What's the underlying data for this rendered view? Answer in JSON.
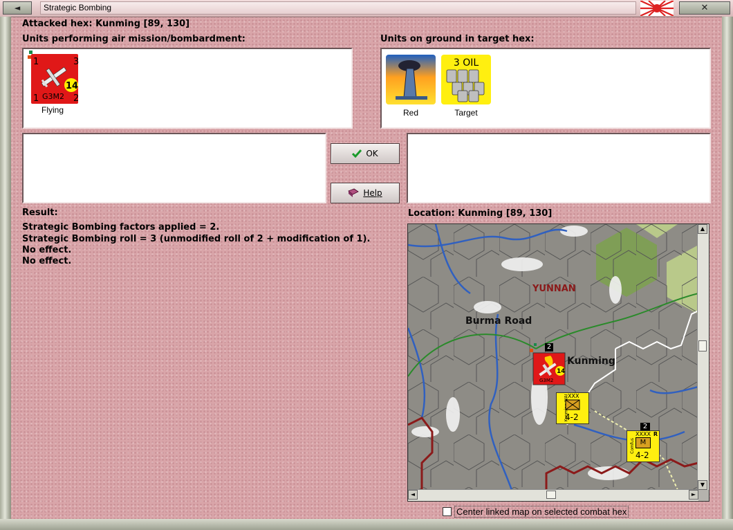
{
  "window": {
    "title": "Strategic Bombing",
    "left_button": "◄",
    "close_button": "✕"
  },
  "header": {
    "attacked_hex": "Attacked hex: Kunming  [89, 130]"
  },
  "air_panel": {
    "heading": "Units performing air mission/bombardment:",
    "units": [
      {
        "model": "G3M2",
        "top_left": "1",
        "top_right": "3",
        "bottom_left": "1",
        "bottom_right": "2",
        "range": "14",
        "status": "Flying"
      }
    ]
  },
  "ground_panel": {
    "heading": "Units on ground in target hex:",
    "units": [
      {
        "label": "Red",
        "icon": "factory-icon"
      },
      {
        "label": "Target",
        "icon": "oil-barrels-icon",
        "badge": "3 OIL"
      }
    ]
  },
  "buttons": {
    "ok": "OK",
    "help": "Help"
  },
  "result": {
    "heading": "Result:",
    "lines": [
      "Strategic Bombing factors applied = 2.",
      "Strategic Bombing roll = 3 (unmodified roll of 2 + modification of 1).",
      "No effect.",
      "No effect."
    ]
  },
  "location": {
    "heading": "Location:  Kunming  [89, 130]"
  },
  "map": {
    "region_label": "YUNNAN",
    "road_label": "Burma Road",
    "city_label": "Kunming",
    "stack_count": "2",
    "corps1": {
      "size": "XXX",
      "name": "Kunming WAI",
      "strength": "4-2"
    },
    "corps2": {
      "size": "XXXX",
      "name": "Comfus",
      "strength": "4-2",
      "count": "2",
      "mark": "R",
      "code": "M"
    },
    "colors": {
      "terrain": "#8e8c86",
      "forest": "#7f9e56",
      "clear": "#b9c98a",
      "road": "#2a8a2a",
      "river": "#3060c0",
      "border": "#8b1a1a"
    }
  },
  "options": {
    "center_linked_map": "Center linked map on selected combat hex",
    "center_linked_map_checked": false
  }
}
